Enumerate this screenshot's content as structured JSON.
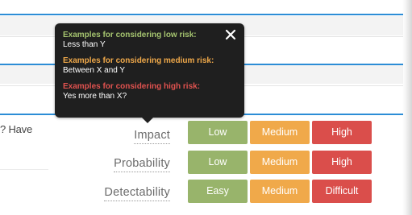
{
  "question": {
    "text": "? Have"
  },
  "tooltip": {
    "sections": [
      {
        "heading": "Examples for considering low risk:",
        "value": "Less than Y"
      },
      {
        "heading": "Examples for considering medium risk:",
        "value": "Between X and Y"
      },
      {
        "heading": "Examples for considering high risk:",
        "value": "Yes more than X?"
      }
    ],
    "close_icon": "close-icon"
  },
  "criteria": [
    {
      "label": "Impact",
      "options": [
        "Low",
        "Medium",
        "High"
      ]
    },
    {
      "label": "Probability",
      "options": [
        "Low",
        "Medium",
        "High"
      ]
    },
    {
      "label": "Detectability",
      "options": [
        "Easy",
        "Medium",
        "Difficult"
      ]
    }
  ],
  "colors": {
    "accent_blue": "#2c8dd6",
    "low_green": "#98b46b",
    "medium_orange": "#f0a94a",
    "high_red": "#da4e4b",
    "tooltip_bg": "#1f1f1f"
  }
}
